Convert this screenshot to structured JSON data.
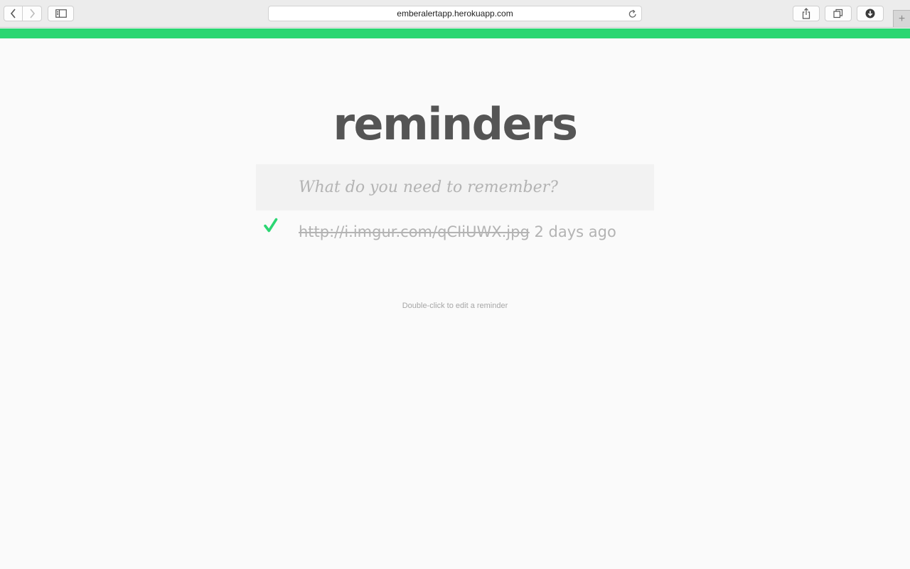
{
  "browser": {
    "url": "emberalertapp.herokuapp.com",
    "icons": {
      "back": "chevron-left-icon",
      "forward": "chevron-right-icon",
      "sidebar": "sidebar-icon",
      "reload": "reload-icon",
      "share": "share-icon",
      "tabs": "tabs-icon",
      "download": "download-icon",
      "new_tab": "plus-icon"
    },
    "new_tab_glyph": "+"
  },
  "colors": {
    "accent": "#2bd672",
    "title": "#555555",
    "muted": "#b3b3b3",
    "background": "#fafafa"
  },
  "app": {
    "title": "reminders",
    "input_placeholder": "What do you need to remember?",
    "input_value": "",
    "reminders": [
      {
        "text": "http://i.imgur.com/qCIiUWX.jpg",
        "time": "2 days ago",
        "completed": true
      }
    ],
    "hint": "Double-click to edit a reminder"
  }
}
